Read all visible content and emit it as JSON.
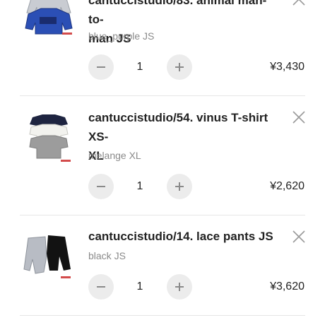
{
  "cart": {
    "items": [
      {
        "title_line1": "cantuccistudio/83. animal man-to-",
        "title_line2": "man JS",
        "variant": "blue_purple JS",
        "quantity": "1",
        "price": "¥3,430",
        "thumbnail_icon": "sweatshirt-photo"
      },
      {
        "title_line1": "cantuccistudio/54. vinus T-shirt XS-",
        "title_line2": "XL",
        "variant": "melange XL",
        "quantity": "1",
        "price": "¥2,620",
        "thumbnail_icon": "tshirt-photo"
      },
      {
        "title_line1": "cantuccistudio/14. lace pants JS",
        "title_line2": "",
        "variant": "black JS",
        "quantity": "1",
        "price": "¥3,620",
        "thumbnail_icon": "pants-photo"
      }
    ]
  },
  "icons": {
    "remove": "close-icon",
    "decrement": "minus-icon",
    "increment": "plus-icon"
  },
  "colors": {
    "stepper_bg": "#ececec",
    "variant_text": "#8a8a8a",
    "divider": "#e6e6e6"
  }
}
